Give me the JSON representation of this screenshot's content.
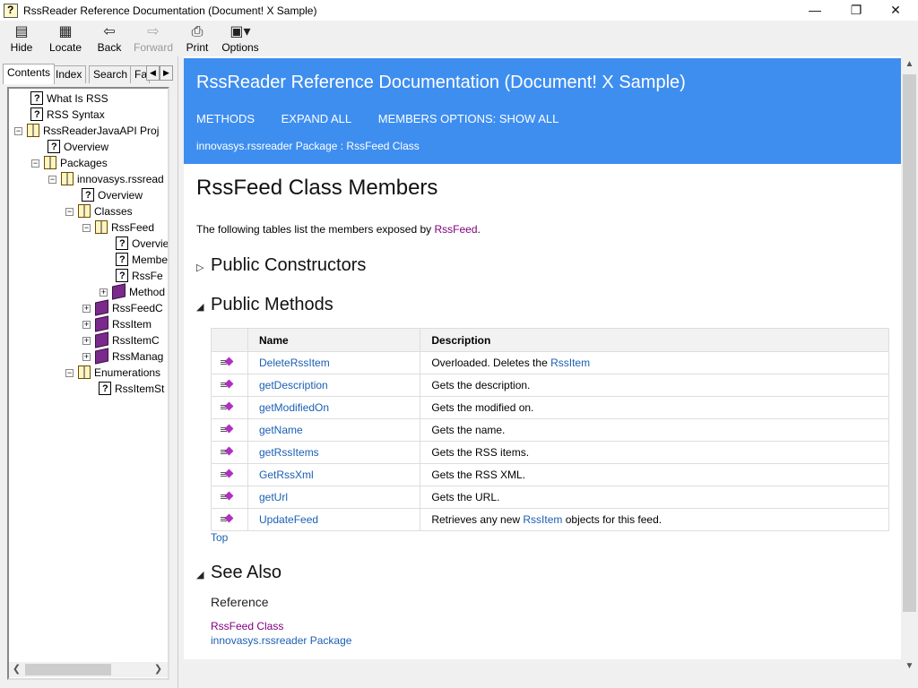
{
  "window": {
    "title": "RssReader Reference Documentation (Document! X Sample)",
    "controls": {
      "minimize": "—",
      "maximize": "❐",
      "close": "✕"
    }
  },
  "toolbar": {
    "hide": "Hide",
    "locate": "Locate",
    "back": "Back",
    "forward": "Forward",
    "print": "Print",
    "options": "Options"
  },
  "tabs": {
    "contents": "Contents",
    "index": "Index",
    "search": "Search",
    "favorites": "Fa"
  },
  "tree": [
    {
      "label": "What Is RSS",
      "icon": "page"
    },
    {
      "label": "RSS Syntax",
      "icon": "page"
    },
    {
      "label": "RssReaderJavaAPI Proj",
      "icon": "book-open"
    },
    {
      "label": "Overview",
      "icon": "page"
    },
    {
      "label": "Packages",
      "icon": "book-open"
    },
    {
      "label": "innovasys.rssread",
      "icon": "book-open"
    },
    {
      "label": "Overview",
      "icon": "page"
    },
    {
      "label": "Classes",
      "icon": "book-open"
    },
    {
      "label": "RssFeed",
      "icon": "book-open"
    },
    {
      "label": "Overvie",
      "icon": "page"
    },
    {
      "label": "Membe",
      "icon": "page"
    },
    {
      "label": "RssFe",
      "icon": "page"
    },
    {
      "label": "Method",
      "icon": "book"
    },
    {
      "label": "RssFeedC",
      "icon": "book"
    },
    {
      "label": "RssItem",
      "icon": "book"
    },
    {
      "label": "RssItemC",
      "icon": "book"
    },
    {
      "label": "RssManag",
      "icon": "book"
    },
    {
      "label": "Enumerations",
      "icon": "book-open"
    },
    {
      "label": "RssItemSt",
      "icon": "page"
    }
  ],
  "banner": {
    "title": "RssReader Reference Documentation (Document! X Sample)",
    "nav": [
      "METHODS",
      "EXPAND ALL",
      "MEMBERS OPTIONS: SHOW ALL"
    ],
    "breadcrumb": "innovasys.rssreader Package : RssFeed Class"
  },
  "page": {
    "heading": "RssFeed Class Members",
    "intro_prefix": "The following tables list the members exposed by ",
    "intro_link": "RssFeed",
    "intro_suffix": ".",
    "sections": {
      "constructors": "Public Constructors",
      "methods": "Public Methods",
      "see_also": "See Also"
    },
    "table_headers": {
      "name": "Name",
      "description": "Description"
    },
    "methods": [
      {
        "name": "DeleteRssItem",
        "desc": "Overloaded. Deletes the ",
        "desc_link": "RssItem",
        "desc_tail": ""
      },
      {
        "name": "getDescription",
        "desc": "Gets the description.",
        "desc_link": "",
        "desc_tail": ""
      },
      {
        "name": "getModifiedOn",
        "desc": "Gets the modified on.",
        "desc_link": "",
        "desc_tail": ""
      },
      {
        "name": "getName",
        "desc": "Gets the name.",
        "desc_link": "",
        "desc_tail": ""
      },
      {
        "name": "getRssItems",
        "desc": "Gets the RSS items.",
        "desc_link": "",
        "desc_tail": ""
      },
      {
        "name": "GetRssXml",
        "desc": "Gets the RSS XML.",
        "desc_link": "",
        "desc_tail": ""
      },
      {
        "name": "getUrl",
        "desc": "Gets the URL.",
        "desc_link": "",
        "desc_tail": ""
      },
      {
        "name": "UpdateFeed",
        "desc": "Retrieves any new ",
        "desc_link": "RssItem",
        "desc_tail": " objects for this feed."
      }
    ],
    "top_link": "Top",
    "reference_label": "Reference",
    "see_also_links": [
      "RssFeed Class",
      "innovasys.rssreader Package"
    ]
  }
}
